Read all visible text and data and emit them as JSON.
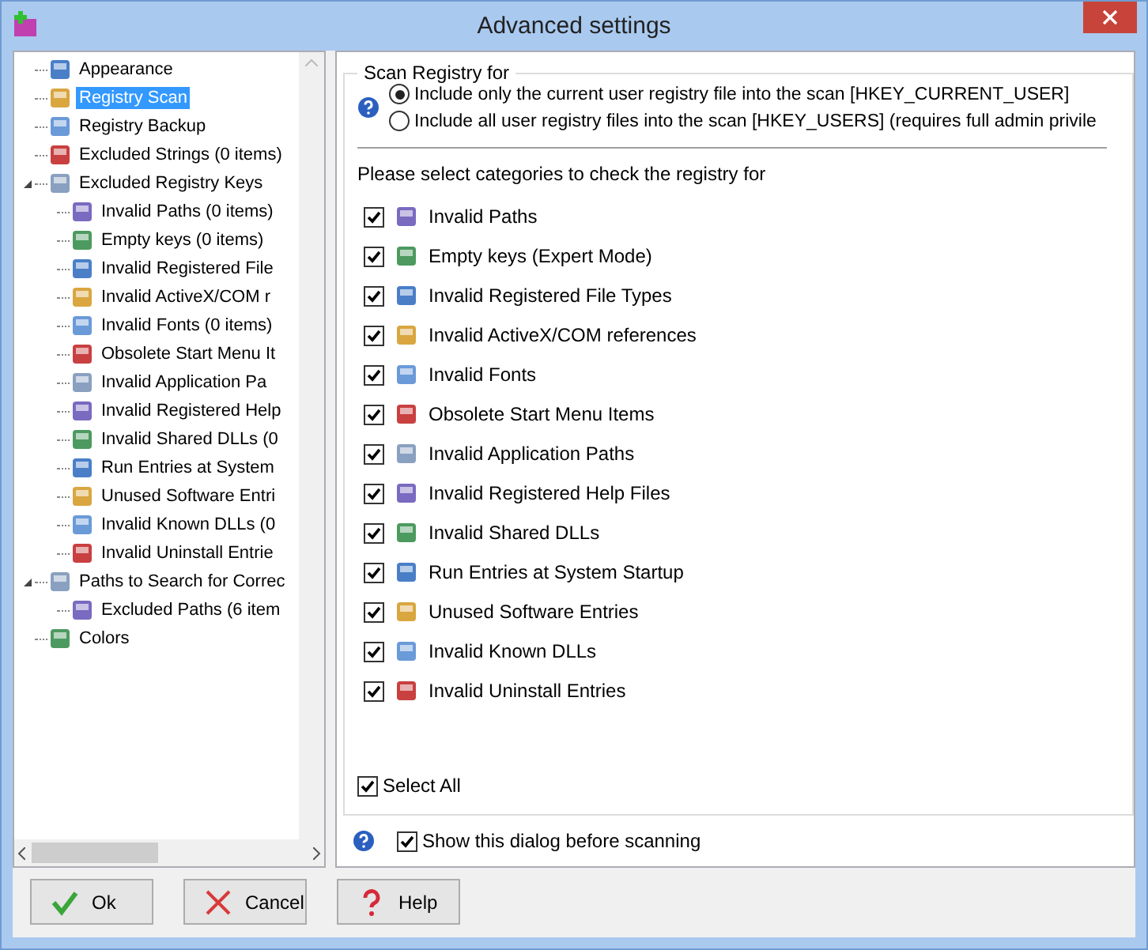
{
  "window": {
    "title": "Advanced settings"
  },
  "tree": [
    {
      "label": "Appearance",
      "selected": false
    },
    {
      "label": "Registry Scan",
      "selected": true
    },
    {
      "label": "Registry Backup",
      "selected": false
    },
    {
      "label": "Excluded Strings (0 items)",
      "selected": false
    },
    {
      "label": "Excluded Registry Keys",
      "selected": false,
      "expanded": true,
      "children": [
        {
          "label": "Invalid Paths (0 items)",
          "selected": false
        },
        {
          "label": "Empty keys (0 items)",
          "selected": false
        },
        {
          "label": "Invalid Registered File",
          "selected": false
        },
        {
          "label": "Invalid ActiveX/COM r",
          "selected": false
        },
        {
          "label": "Invalid Fonts (0 items)",
          "selected": false
        },
        {
          "label": "Obsolete Start Menu It",
          "selected": false
        },
        {
          "label": "Invalid Application Pa",
          "selected": false
        },
        {
          "label": "Invalid Registered Help",
          "selected": false
        },
        {
          "label": "Invalid Shared DLLs (0",
          "selected": false
        },
        {
          "label": "Run Entries at System",
          "selected": false
        },
        {
          "label": "Unused Software Entri",
          "selected": false
        },
        {
          "label": "Invalid Known DLLs (0",
          "selected": false
        },
        {
          "label": "Invalid Uninstall Entrie",
          "selected": false
        }
      ]
    },
    {
      "label": "Paths to Search for Correc",
      "selected": false,
      "expanded": true,
      "children": [
        {
          "label": "Excluded Paths (6 item",
          "selected": false
        }
      ]
    },
    {
      "label": "Colors",
      "selected": false
    }
  ],
  "scan_group": {
    "title": "Scan Registry for",
    "options": [
      {
        "label": "Include only the current user registry file into the scan [HKEY_CURRENT_USER]",
        "selected": true
      },
      {
        "label": "Include all user registry files into the scan [HKEY_USERS] (requires full admin privile",
        "selected": false
      }
    ]
  },
  "categories_heading": "Please select categories to check the registry for",
  "categories": [
    {
      "label": "Invalid Paths",
      "checked": true
    },
    {
      "label": "Empty keys (Expert Mode)",
      "checked": true
    },
    {
      "label": "Invalid Registered File Types",
      "checked": true
    },
    {
      "label": "Invalid ActiveX/COM references",
      "checked": true
    },
    {
      "label": "Invalid Fonts",
      "checked": true
    },
    {
      "label": "Obsolete Start Menu Items",
      "checked": true
    },
    {
      "label": "Invalid Application Paths",
      "checked": true
    },
    {
      "label": "Invalid Registered Help Files",
      "checked": true
    },
    {
      "label": "Invalid Shared DLLs",
      "checked": true
    },
    {
      "label": "Run Entries at System Startup",
      "checked": true
    },
    {
      "label": "Unused Software Entries",
      "checked": true
    },
    {
      "label": "Invalid Known DLLs",
      "checked": true
    },
    {
      "label": "Invalid Uninstall Entries",
      "checked": true
    }
  ],
  "select_all": {
    "label": "Select All",
    "checked": true
  },
  "show_dialog": {
    "label": "Show this dialog before scanning",
    "checked": true
  },
  "buttons": [
    {
      "label": "Ok",
      "kind": "ok"
    },
    {
      "label": "Cancel",
      "kind": "cancel"
    },
    {
      "label": "Help",
      "kind": "help"
    }
  ]
}
